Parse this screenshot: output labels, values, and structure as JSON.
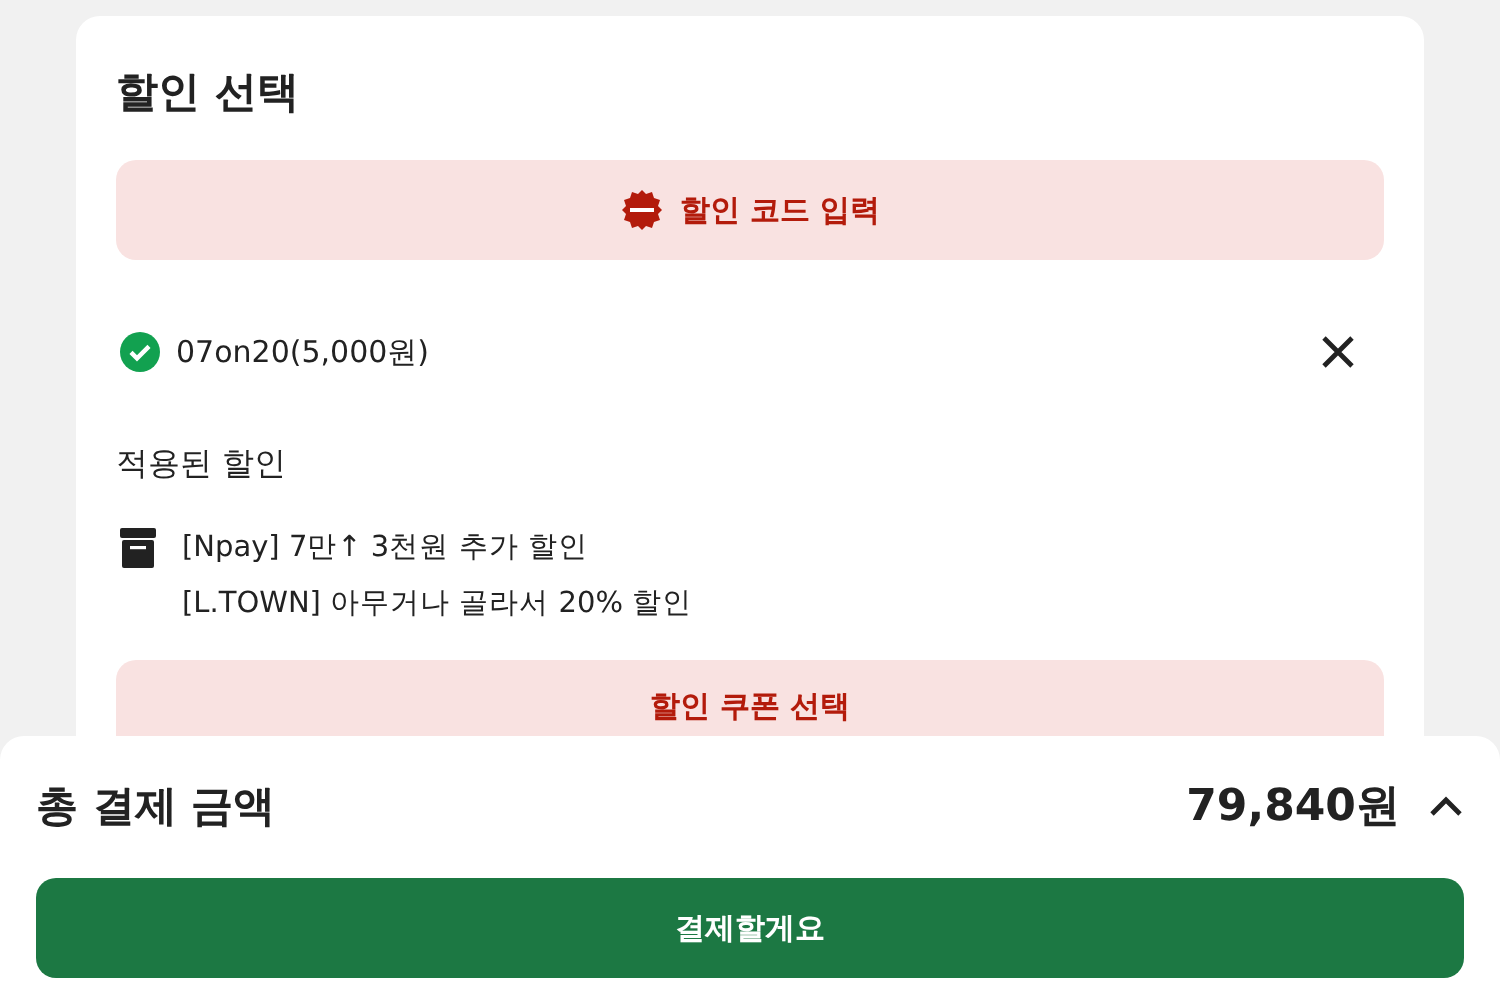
{
  "discount_section": {
    "title": "할인 선택",
    "code_button": "할인 코드 입력",
    "applied_code": "07on20(5,000원)",
    "applied_label": "적용된 할인",
    "applied_discounts": [
      "[Npay] 7만↑ 3천원 추가 할인",
      "[L.TOWN] 아무거나 골라서 20% 할인"
    ],
    "coupon_button": "할인 쿠폰 선택"
  },
  "summary": {
    "label": "총 결제 금액",
    "amount": "79,840원",
    "pay_button": "결제할게요"
  }
}
